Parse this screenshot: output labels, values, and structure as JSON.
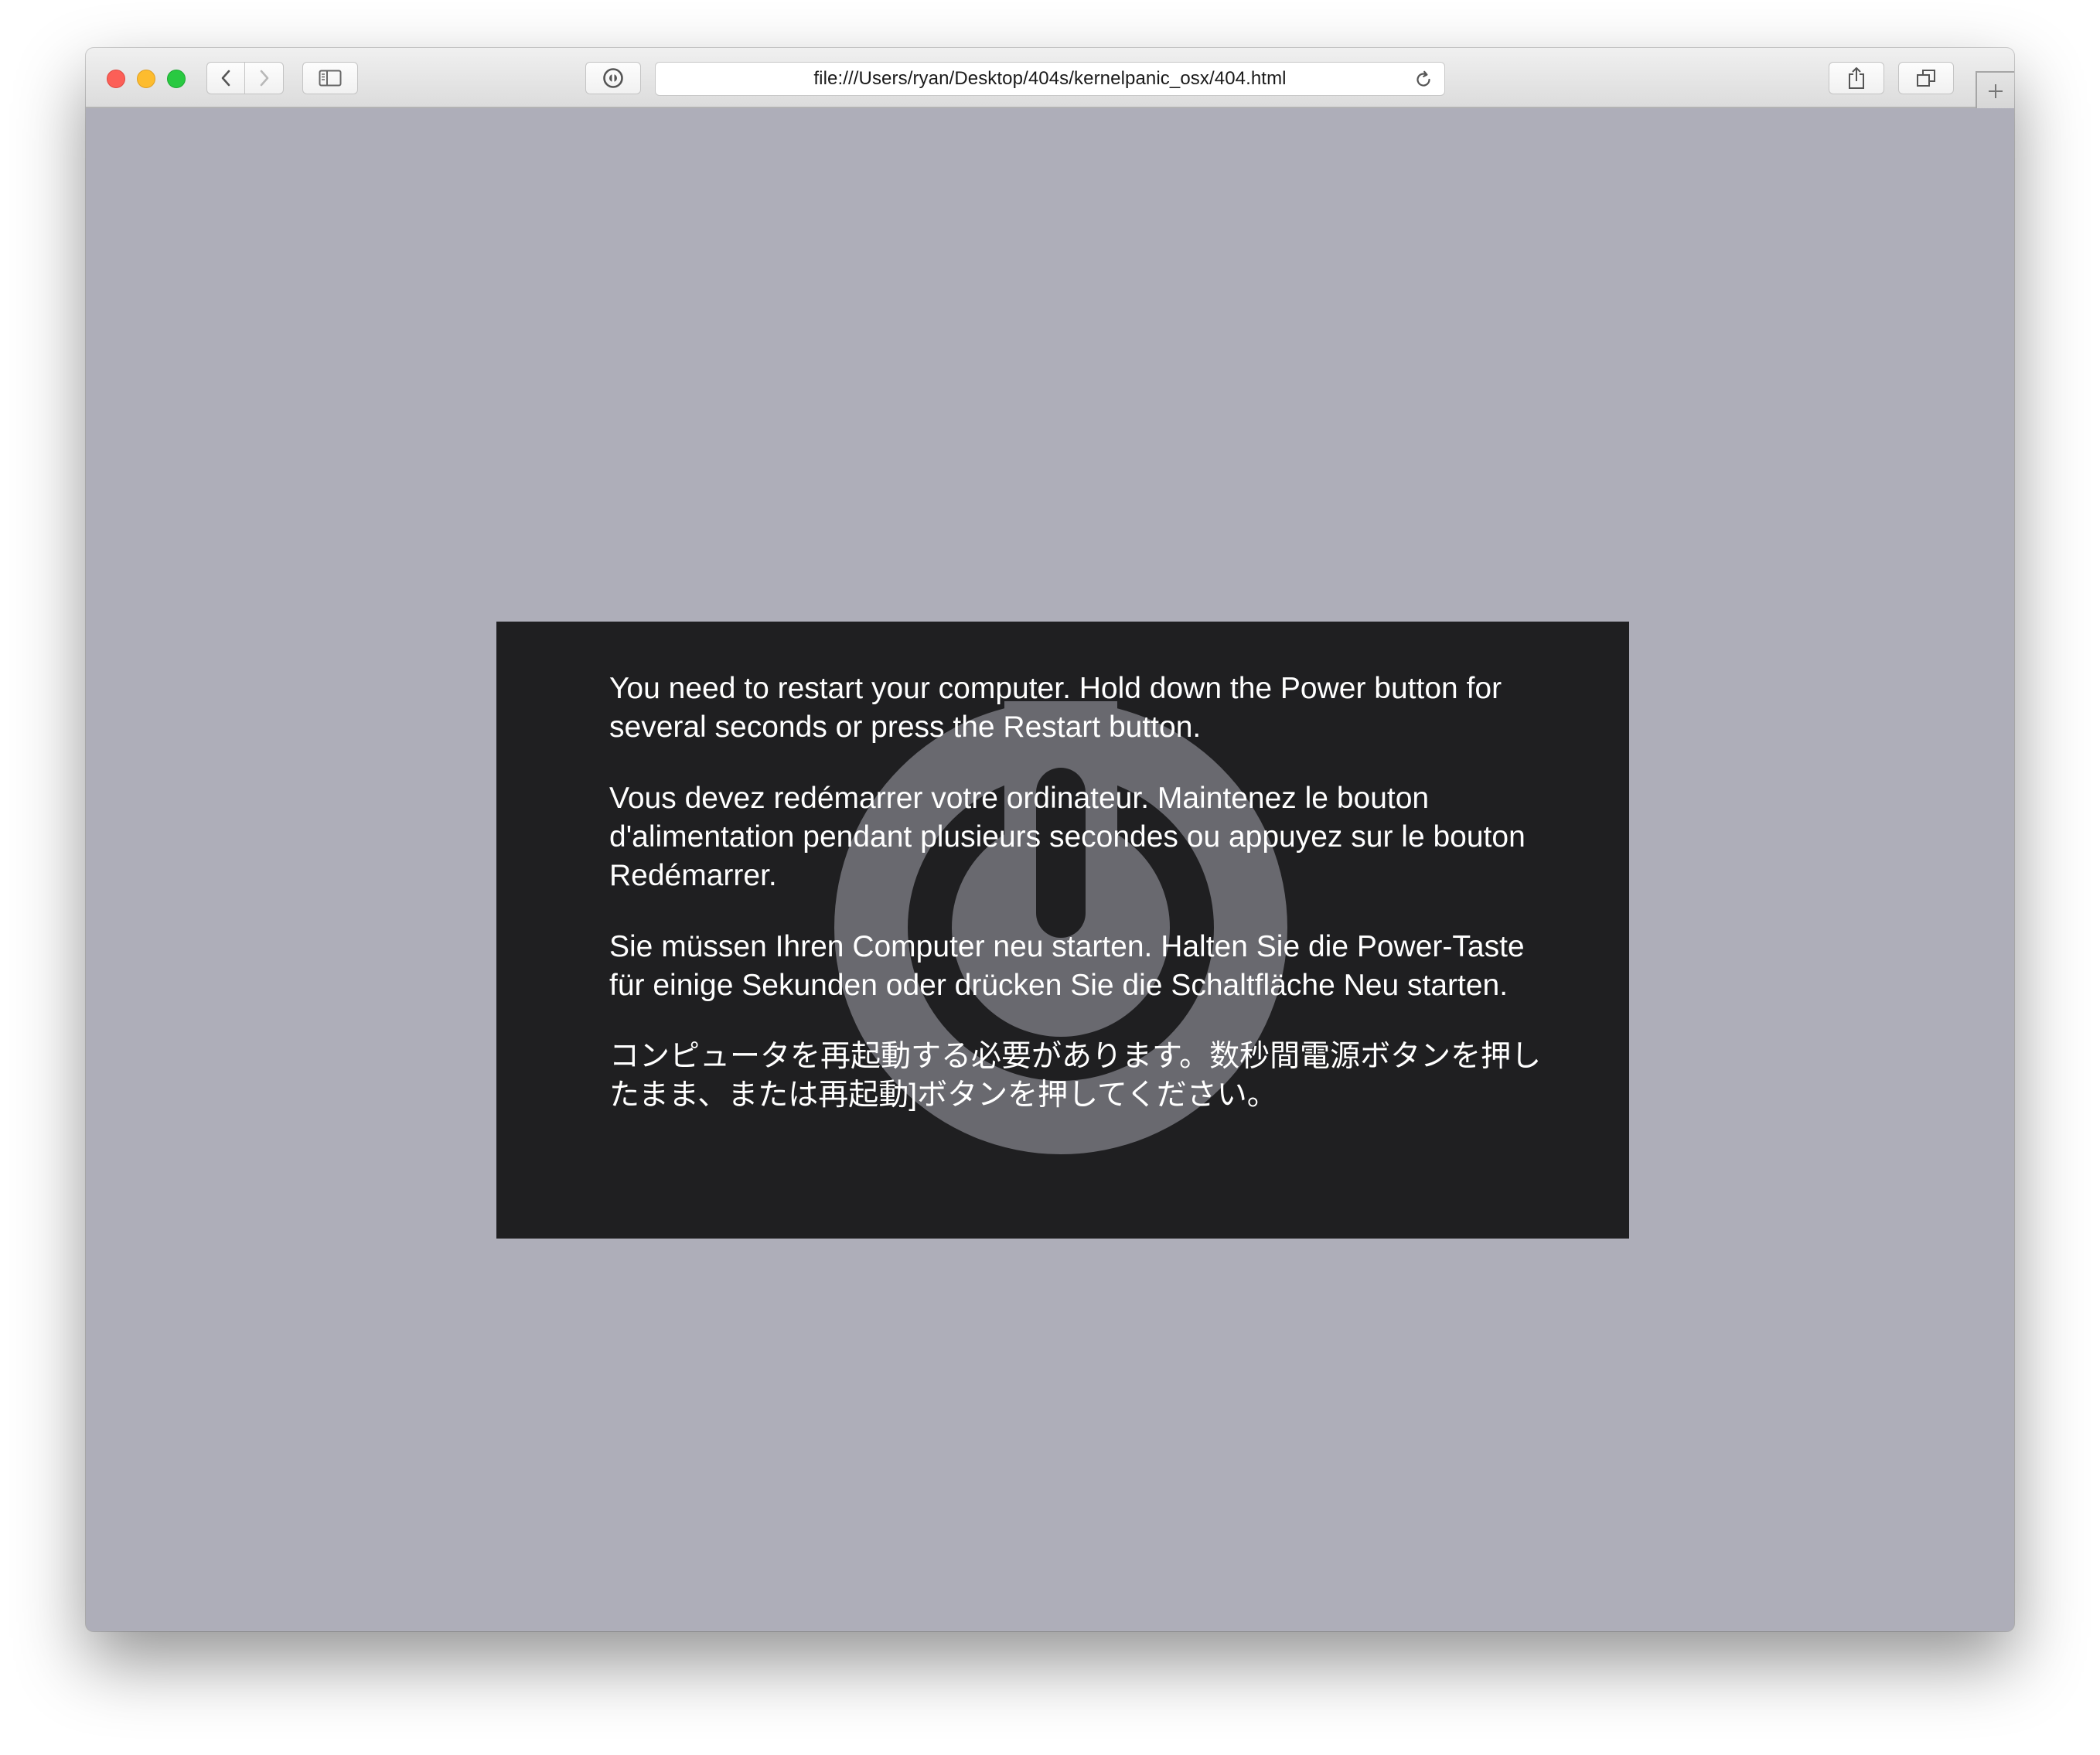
{
  "browser": {
    "address_bar": {
      "url": "file:///Users/ryan/Desktop/404s/kernelpanic_osx/404.html"
    },
    "toolbar_icons": [
      "back-icon",
      "forward-icon",
      "sidebar-icon",
      "privacy-icon",
      "reload-icon",
      "share-icon",
      "tabs-icon",
      "plus-icon"
    ],
    "colors": {
      "close": "#fc5f57",
      "minimize": "#fdbc2e",
      "zoom": "#29c941"
    }
  },
  "page": {
    "background_color": "#aeaeb9",
    "panel_color": "#1f1f21",
    "watermark_icon": "power-icon",
    "messages": {
      "en": "You need to restart your computer. Hold down the Power button for several seconds or press the Restart button.",
      "fr": "Vous devez redémarrer votre ordinateur. Maintenez le bouton d'alimentation pendant plusieurs secondes ou appuyez sur le bouton Redémarrer.",
      "de": "Sie müssen Ihren Computer neu starten. Halten Sie die Power-Taste für einige Sekunden oder drücken Sie die Schaltfläche Neu starten.",
      "ja": "コンピュータを再起動する必要があります。数秒間電源ボタンを押したまま、または再起動]ボタンを押してください。"
    }
  }
}
